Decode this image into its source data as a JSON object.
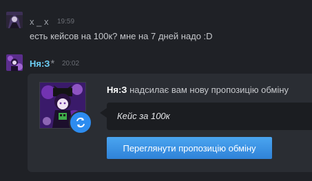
{
  "messages": [
    {
      "username": "x _ x",
      "time": "19:59",
      "text": "есть кейсов на 100к? мне на 7 дней надо :D"
    },
    {
      "username": "Ня:З",
      "star": "*",
      "time": "20:02"
    }
  ],
  "trade_offer": {
    "sender": "Ня:З",
    "action_text": "надсилає вам нову пропозицію обміну",
    "message": "Кейс за 100к",
    "button_label": "Переглянути пропозицію обміну"
  },
  "colors": {
    "background": "#1f2126",
    "card": "#2a2d33",
    "bubble": "#1b1d21",
    "accent_blue": "#2d8cf0",
    "username_blue": "#6dcff6"
  },
  "icons": {
    "swap": "trade-swap-icon"
  }
}
